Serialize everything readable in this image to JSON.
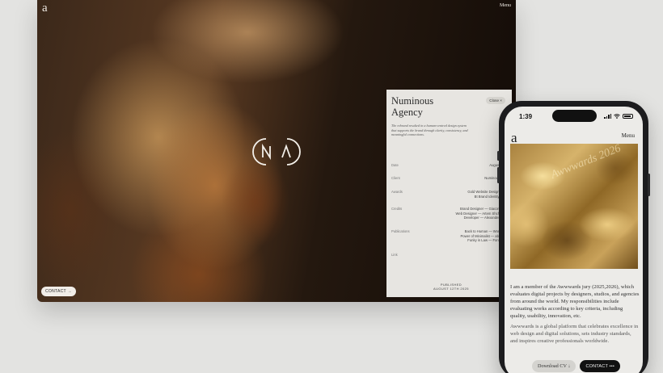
{
  "desktop": {
    "logo": "a",
    "menu_label": "Menu",
    "contact_label": "CONTACT →",
    "mark": "NA-monogram"
  },
  "panel": {
    "title": "Numinous Agency",
    "close_label": "Close  ×",
    "description": "The rebrand resulted in a human-centred design system that supports the brand through clarity, consistency, and meaningful connections.",
    "rows": [
      {
        "label": "Date",
        "values": [
          "August 12th —"
        ]
      },
      {
        "label": "Client",
        "values": [
          "Numinous Agency"
        ]
      },
      {
        "label": "Awards",
        "values": [
          "Gold Website Design — CDA",
          "Bt Brand Identity — CDA"
        ]
      },
      {
        "label": "Credits",
        "values": [
          "Brand Designer — Giacomo Rossi",
          "Web Designer — Artem Shcherbakov",
          "Developer — Alexander Chinow"
        ]
      },
      {
        "label": "Publications",
        "values": [
          "Back to Human — World Brand",
          "Power of Minimalist — abduzeedo",
          "Funky in Law — Fonts in Use"
        ]
      },
      {
        "label": "Link",
        "values": [
          ""
        ]
      }
    ],
    "published_label": "PUBLISHED",
    "published_date": "AUGUST 12TH 2025"
  },
  "phone": {
    "time": "1:39",
    "logo": "a",
    "menu_label": "Menu",
    "image_script": "Awwwards 2026",
    "paragraphs": [
      "I am a member of the Awwwards jury (2025,2026), which evaluates digital projects by designers, studios, and agencies from around the world. My responsibilities include evaluating works according to key criteria, including quality, usability, innovation, etc.",
      "Awwwards is a global platform that celebrates excellence in web design and digital solutions, sets industry standards, and inspires creative professionals worldwide."
    ],
    "download_label": "Download CV ↓",
    "contact_label": "CONTACT •••"
  },
  "colors": {
    "page_bg": "#e3e3e1",
    "panel_bg": "#e7e5e1",
    "phone_frame": "#1c1c1e",
    "accent_dark": "#111111"
  }
}
